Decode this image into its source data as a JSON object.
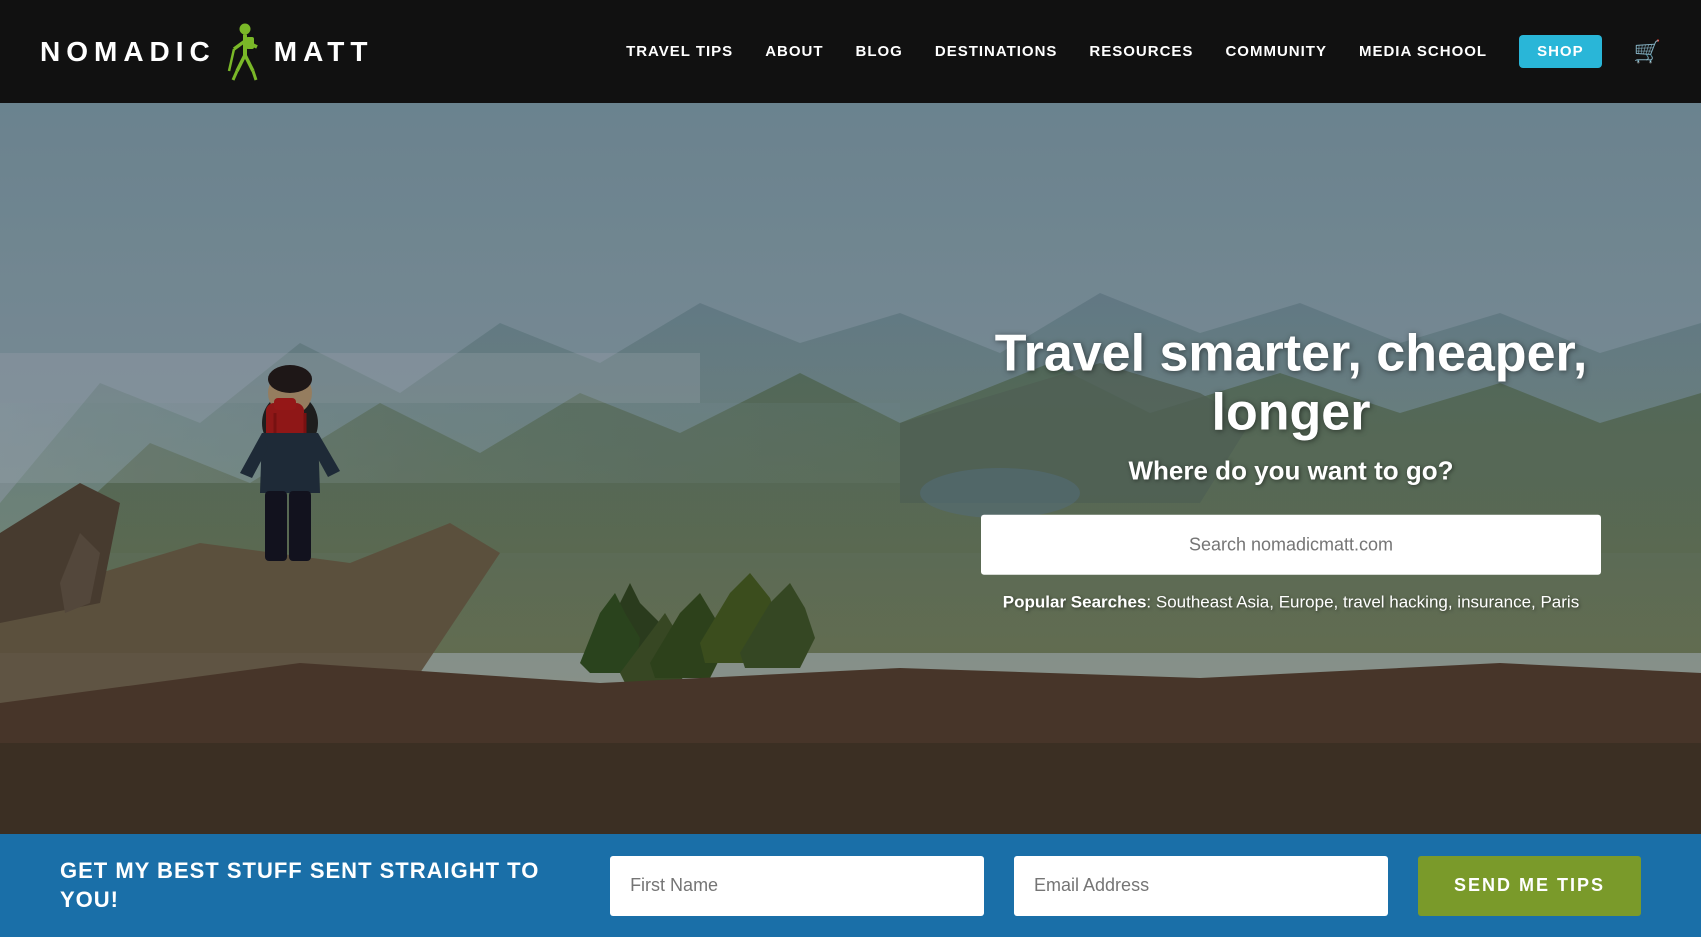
{
  "header": {
    "logo_text_before": "NOMADIC",
    "logo_text_after": "MATT",
    "nav_items": [
      {
        "label": "TRAVEL TIPS",
        "id": "travel-tips",
        "active": false,
        "is_shop": false
      },
      {
        "label": "ABOUT",
        "id": "about",
        "active": false,
        "is_shop": false
      },
      {
        "label": "BLOG",
        "id": "blog",
        "active": false,
        "is_shop": false
      },
      {
        "label": "DESTINATIONS",
        "id": "destinations",
        "active": false,
        "is_shop": false
      },
      {
        "label": "RESOURCES",
        "id": "resources",
        "active": false,
        "is_shop": false
      },
      {
        "label": "COMMUNITY",
        "id": "community",
        "active": false,
        "is_shop": false
      },
      {
        "label": "MEDIA SCHOOL",
        "id": "media-school",
        "active": false,
        "is_shop": false
      },
      {
        "label": "SHOP",
        "id": "shop",
        "active": false,
        "is_shop": true
      }
    ]
  },
  "hero": {
    "title": "Travel smarter, cheaper, longer",
    "subtitle": "Where do you want to go?",
    "search_placeholder": "Search nomadicmatt.com",
    "popular_label": "Popular Searches",
    "popular_searches": ": Southeast Asia, Europe, travel hacking, insurance, Paris"
  },
  "footer_bar": {
    "cta_text": "GET MY BEST STUFF SENT STRAIGHT TO YOU!",
    "first_name_placeholder": "First Name",
    "email_placeholder": "Email Address",
    "submit_label": "SEND ME TIPS"
  },
  "colors": {
    "header_bg": "#111111",
    "shop_btn": "#29b6d8",
    "footer_bar_bg": "#1a6fa8",
    "submit_btn": "#7a9a2a",
    "logo_icon": "#7ab828"
  }
}
